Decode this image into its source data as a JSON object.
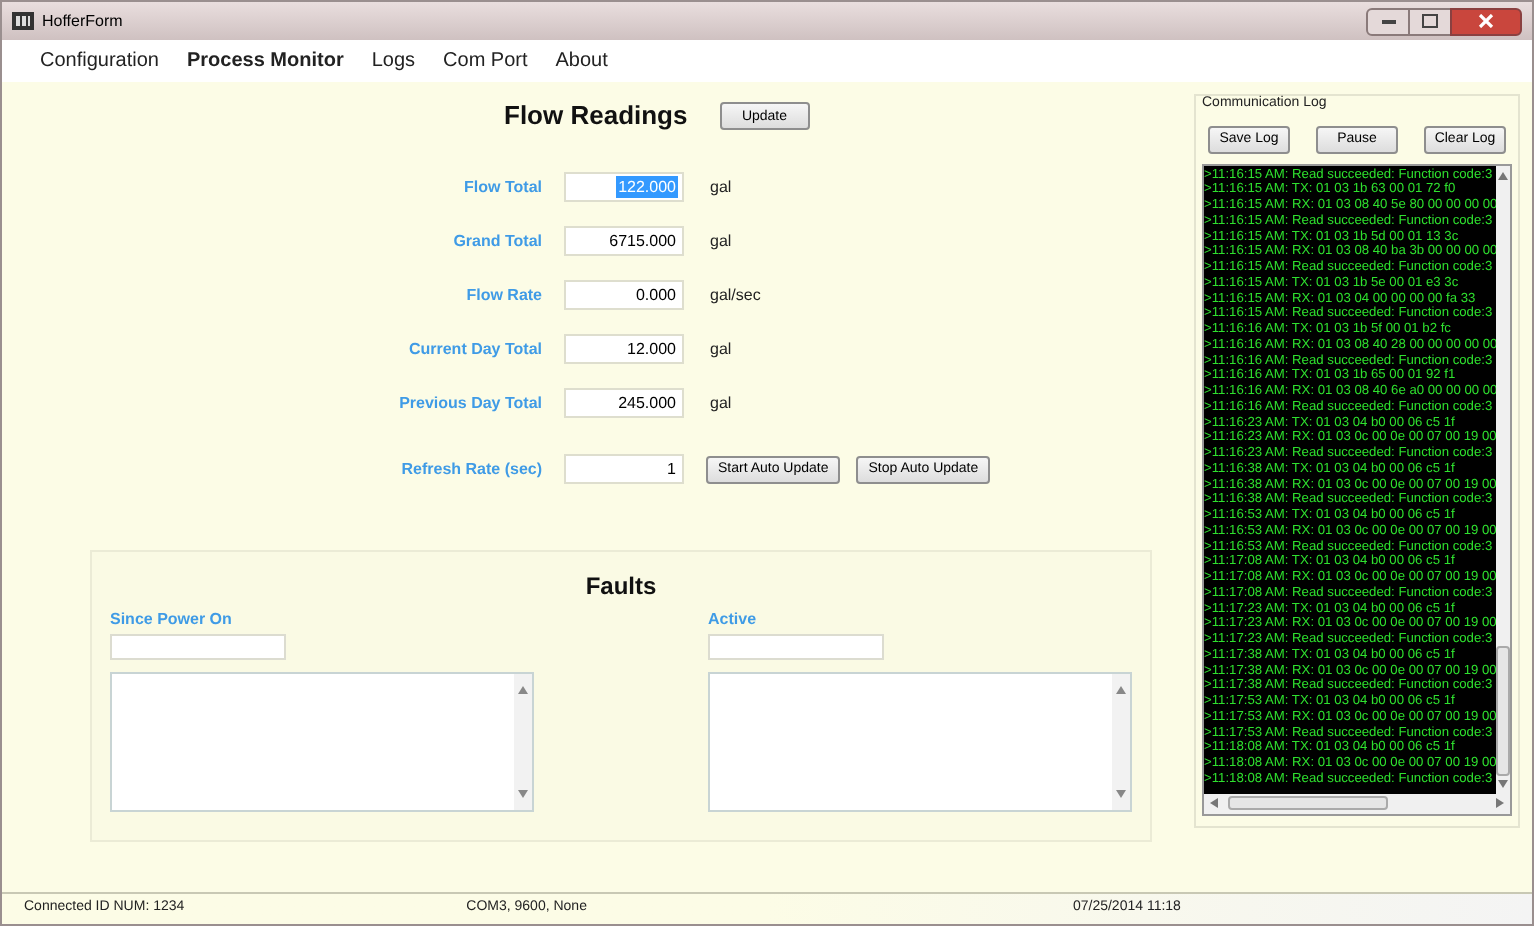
{
  "window": {
    "title": "HofferForm"
  },
  "menu": [
    {
      "label": "Configuration",
      "selected": false
    },
    {
      "label": "Process Monitor",
      "selected": true
    },
    {
      "label": "Logs",
      "selected": false
    },
    {
      "label": "Com Port",
      "selected": false
    },
    {
      "label": "About",
      "selected": false
    }
  ],
  "flow_readings": {
    "title": "Flow Readings",
    "update_button": "Update",
    "fields": [
      {
        "label": "Flow Total",
        "value": "122.000",
        "unit": "gal",
        "highlighted": true
      },
      {
        "label": "Grand Total",
        "value": "6715.000",
        "unit": "gal",
        "highlighted": false
      },
      {
        "label": "Flow Rate",
        "value": "0.000",
        "unit": "gal/sec",
        "highlighted": false
      },
      {
        "label": "Current Day Total",
        "value": "12.000",
        "unit": "gal",
        "highlighted": false
      },
      {
        "label": "Previous Day Total",
        "value": "245.000",
        "unit": "gal",
        "highlighted": false
      }
    ],
    "refresh": {
      "label": "Refresh Rate (sec)",
      "value": "1",
      "buttons": [
        "Start Auto Update",
        "Stop Auto Update"
      ]
    }
  },
  "faults": {
    "title": "Faults",
    "panels": [
      {
        "label": "Since Power On"
      },
      {
        "label": "Active"
      }
    ]
  },
  "communication_log": {
    "title": "Communication Log",
    "buttons": [
      "Save Log",
      "Pause",
      "Clear Log"
    ],
    "lines": [
      ">11:16:15 AM: Read succeeded: Function code:3",
      ">11:16:15 AM: TX: 01 03 1b 63 00 01 72 f0",
      ">11:16:15 AM: RX: 01 03 08 40 5e 80 00 00 00 00",
      ">11:16:15 AM: Read succeeded: Function code:3",
      ">11:16:15 AM: TX: 01 03 1b 5d 00 01 13 3c",
      ">11:16:15 AM: RX: 01 03 08 40 ba 3b 00 00 00 00",
      ">11:16:15 AM: Read succeeded: Function code:3",
      ">11:16:15 AM: TX: 01 03 1b 5e 00 01 e3 3c",
      ">11:16:15 AM: RX: 01 03 04 00 00 00 00 fa 33",
      ">11:16:15 AM: Read succeeded: Function code:3",
      ">11:16:16 AM: TX: 01 03 1b 5f 00 01 b2 fc",
      ">11:16:16 AM: RX: 01 03 08 40 28 00 00 00 00 00",
      ">11:16:16 AM: Read succeeded: Function code:3",
      ">11:16:16 AM: TX: 01 03 1b 65 00 01 92 f1",
      ">11:16:16 AM: RX: 01 03 08 40 6e a0 00 00 00 00",
      ">11:16:16 AM: Read succeeded: Function code:3",
      ">11:16:23 AM: TX: 01 03 04 b0 00 06 c5 1f",
      ">11:16:23 AM: RX: 01 03 0c 00 0e 00 07 00 19 00",
      ">11:16:23 AM: Read succeeded: Function code:3",
      ">11:16:38 AM: TX: 01 03 04 b0 00 06 c5 1f",
      ">11:16:38 AM: RX: 01 03 0c 00 0e 00 07 00 19 00",
      ">11:16:38 AM: Read succeeded: Function code:3",
      ">11:16:53 AM: TX: 01 03 04 b0 00 06 c5 1f",
      ">11:16:53 AM: RX: 01 03 0c 00 0e 00 07 00 19 00",
      ">11:16:53 AM: Read succeeded: Function code:3",
      ">11:17:08 AM: TX: 01 03 04 b0 00 06 c5 1f",
      ">11:17:08 AM: RX: 01 03 0c 00 0e 00 07 00 19 00",
      ">11:17:08 AM: Read succeeded: Function code:3",
      ">11:17:23 AM: TX: 01 03 04 b0 00 06 c5 1f",
      ">11:17:23 AM: RX: 01 03 0c 00 0e 00 07 00 19 00",
      ">11:17:23 AM: Read succeeded: Function code:3",
      ">11:17:38 AM: TX: 01 03 04 b0 00 06 c5 1f",
      ">11:17:38 AM: RX: 01 03 0c 00 0e 00 07 00 19 00",
      ">11:17:38 AM: Read succeeded: Function code:3",
      ">11:17:53 AM: TX: 01 03 04 b0 00 06 c5 1f",
      ">11:17:53 AM: RX: 01 03 0c 00 0e 00 07 00 19 00",
      ">11:17:53 AM: Read succeeded: Function code:3",
      ">11:18:08 AM: TX: 01 03 04 b0 00 06 c5 1f",
      ">11:18:08 AM: RX: 01 03 0c 00 0e 00 07 00 19 00",
      ">11:18:08 AM: Read succeeded: Function code:3"
    ]
  },
  "status_bar": [
    "Connected ID NUM: 1234",
    "COM3, 9600, None",
    "07/25/2014 11:18"
  ]
}
